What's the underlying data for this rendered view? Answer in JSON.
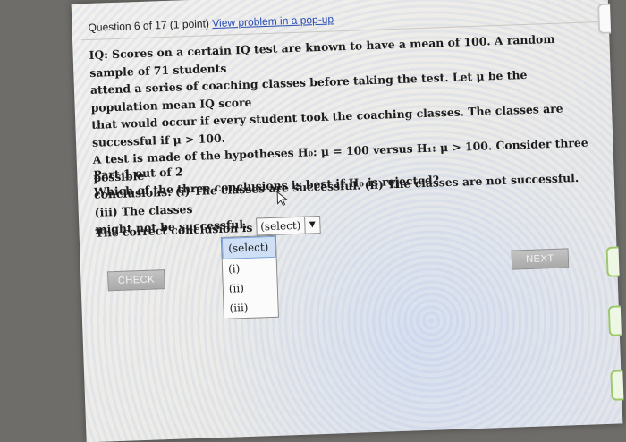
{
  "header": {
    "question_counter": "Question 6 of 17 (1 point)",
    "popup_link": "View problem in a pop-up"
  },
  "problem": {
    "line1": "IQ: Scores on a certain IQ test are known to have a mean of 100. A random sample of 71 students",
    "line2": "attend a series of coaching classes before taking the test. Let μ be the population mean IQ score",
    "line3": "that would occur if every student took the coaching classes. The classes are successful if μ > 100.",
    "line4": "A test is made of the hypotheses H₀: μ = 100 versus H₁: μ > 100. Consider three possible",
    "line5": "conclusions: (i) The classes are successful. (ii) The classes are not successful. (iii) The classes",
    "line6": "might not be successful."
  },
  "part": {
    "label": "Part 1 out of 2",
    "question": "Which of the three conclusions is best if H₀ is rejected?"
  },
  "answer": {
    "prompt": "The correct conclusion is",
    "selected": "(select)",
    "options": [
      "(select)",
      "(i)",
      "(ii)",
      "(iii)"
    ]
  },
  "buttons": {
    "check": "CHECK",
    "next": "NEXT"
  }
}
